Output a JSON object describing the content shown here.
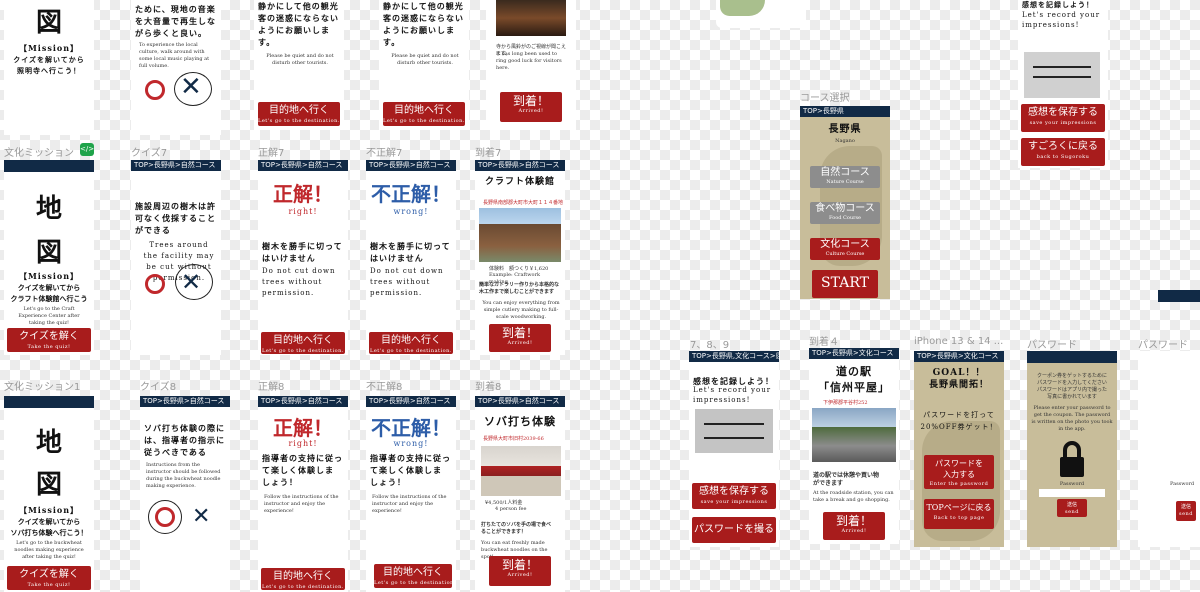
{
  "frame_labels": [
    "文化ミッション",
    "クイズ7",
    "正解7",
    "不正解7",
    "到着7",
    "文化ミッション1",
    "クイズ8",
    "正解8",
    "不正解8",
    "到着8",
    "コース選択",
    "7、8、9",
    "到着４",
    "iPhone 13 & 14 ...",
    "パスワード",
    "パスワード"
  ],
  "nav": {
    "nature": "TOP>長野県>自然コース",
    "pref": "TOP>長野県",
    "culture": "TOP>長野県>文化コース",
    "cult_comma": "TOP>長野県,文化コース>感想"
  },
  "buttons": {
    "go_jp": "目的地へ行く",
    "go_en": "Let's go to the destination.",
    "arrived_jp": "到着！",
    "arrived_en": "Arrived!",
    "quiz_jp": "クイズを解く",
    "quiz_en": "Take the quiz!",
    "save_jp": "感想を保存する",
    "save_en": "save your impressions",
    "sugo_jp": "すごろくに戻る",
    "sugo_en": "back to Sugoroku",
    "pw_jp": "パスワードを撮る",
    "pwin_jp": "パスワードを\n入力する",
    "pwin_en": "Enter the password",
    "top_jp": "TOPページに戻る",
    "top_en": "Back to top page",
    "send_jp": "送信",
    "send_en": "send",
    "start": "START"
  },
  "mission": {
    "map1": "地",
    "map2": "図",
    "label": "【Mission】",
    "m0": "クイズを解いてから\n照明寺へ行こう！",
    "m7": "クイズを解いてから\nクラフト体験館へ行こう",
    "m7en": "Let's go to the Craft Experience Center after taking the quiz!",
    "m8": "クイズを解いてから\nソバ打ち体験へ行こう！",
    "m8en": "Let's go to the buckwheat noodles making experience after taking the quiz!"
  },
  "quiz6": {
    "q": "ために、現地の音楽\nを大音量で再生しな\nがら歩くと良い。",
    "en": "To experience the local culture, walk around with some local music playing at full volume."
  },
  "quiet": {
    "jp": "静かにして他の観光\n客の迷惑にならない\nようにお願いします。",
    "en": "Please be quiet and do not disturb other tourists."
  },
  "arr6": {
    "jp": "寺から風鈴がのご視線が聞こえます。",
    "en": "It has long been used to ring good luck for visitors here."
  },
  "quiz7": {
    "q": "施設周辺の樹木は許\n可なく伐採すること\nができる",
    "en": "Trees around the facility may be cut without permission."
  },
  "answer": {
    "correct": "正解！",
    "correct_en": "right!",
    "wrong": "不正解！",
    "wrong_en": "wrong!"
  },
  "ans7": {
    "jp": "樹木を勝手に切って\nはいけません",
    "en": "Do not cut down trees without permission."
  },
  "arr7": {
    "title": "クラフト体験館",
    "addr": "長野県南部郡大町市大町１１４番地",
    "cap": "体験料　額つくり￥1,620",
    "cap_en": "Example: Craftwork making",
    "body": "簡単なカトラリー作りから本格的な\n木工作まで楽しむことができます",
    "body_en": "You can enjoy everything from simple cutlery making to full-scale woodworking."
  },
  "quiz8": {
    "q": "ソバ打ち体験の際に\nは、指導者の指示に\n従うべきである",
    "en": "Instructions from the instructor should be followed during the buckwheat noodle making experience."
  },
  "ans8": {
    "jp": "指導者の支持に従っ\nて楽しく体験しま\nしょう！",
    "en": "Follow the instructions of the instructor and enjoy the experience!"
  },
  "arr8": {
    "title": "ソバ打ち体験",
    "addr": "長野県大町市旧村2039-66",
    "price": "¥4,500/1人料金",
    "price_en": "4 person fee",
    "body": "打ちたてのソバを手の場で食べ\nることができます！",
    "body_en": "You can eat freshly made buckwheat noodles on the spot!"
  },
  "course": {
    "pref": "長野県",
    "pref_en": "Nagano",
    "nature": "自然コース",
    "nature_en": "Nature Course",
    "food": "食べ物コース",
    "food_en": "Food Course",
    "culture": "文化コース",
    "culture_en": "Culture Course"
  },
  "record": {
    "jp": "感想を記録しよう！",
    "en": "Let's record your\nimpressions!",
    "top_jp": "感想を記録しよう！",
    "top_en": "Let's record your\nimpressions!"
  },
  "station": {
    "title": "道の駅\n「信州平屋」",
    "addr": "下伊那郡平谷村252",
    "body": "道の駅では休憩や買い物\nができます",
    "body_en": "At the roadside station, you can take a break and go shopping."
  },
  "goal": {
    "jp": "GOAL！！\n長野県間拓！",
    "sub": "パスワードを打って\n20%OFF券ゲット！"
  },
  "password": {
    "jp": "クーポン券をゲットするために\nパスワードを入力してください\nパスワードはアプリ内で撮った\n写真に書かれています",
    "en": "Please enter your password to get the coupon. The password is written on the photo you took in the app.",
    "label": "Password",
    "dots": "●●●●"
  },
  "colors": {
    "navy": "#112a46",
    "red": "#a81c1c",
    "parchment": "#c8bd9a"
  },
  "icons": [
    "lock-icon",
    "code-icon"
  ]
}
